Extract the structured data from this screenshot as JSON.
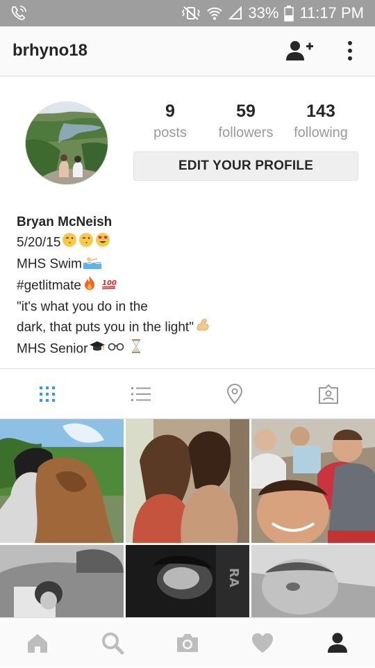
{
  "status_bar": {
    "battery": "33%",
    "time": "11:17 PM"
  },
  "header": {
    "username": "brhyno18",
    "add_user_icon": "add-person-icon",
    "more_icon": "vertical-dots-icon"
  },
  "stats": {
    "posts_count": "9",
    "posts_label": "posts",
    "followers_count": "59",
    "followers_label": "followers",
    "following_count": "143",
    "following_label": "following"
  },
  "edit_button": "EDIT YOUR PROFILE",
  "bio": {
    "name": "Bryan McNeish",
    "line1": "5/20/15",
    "line2": "MHS Swim",
    "line3": "#getlitmate",
    "line4": "\"it's what you do in the",
    "line5": "dark, that puts you in the light\"",
    "line6": "MHS Senior"
  },
  "tabs": [
    "grid-icon",
    "list-icon",
    "location-pin-icon",
    "tagged-photos-icon"
  ],
  "bottom_nav": [
    "home-icon",
    "search-icon",
    "camera-icon",
    "heart-icon",
    "profile-icon"
  ],
  "colors": {
    "status_bar": "#9e9e9e",
    "accent_blue": "#3897f0",
    "text": "#262626",
    "muted": "#9a9a9a"
  }
}
